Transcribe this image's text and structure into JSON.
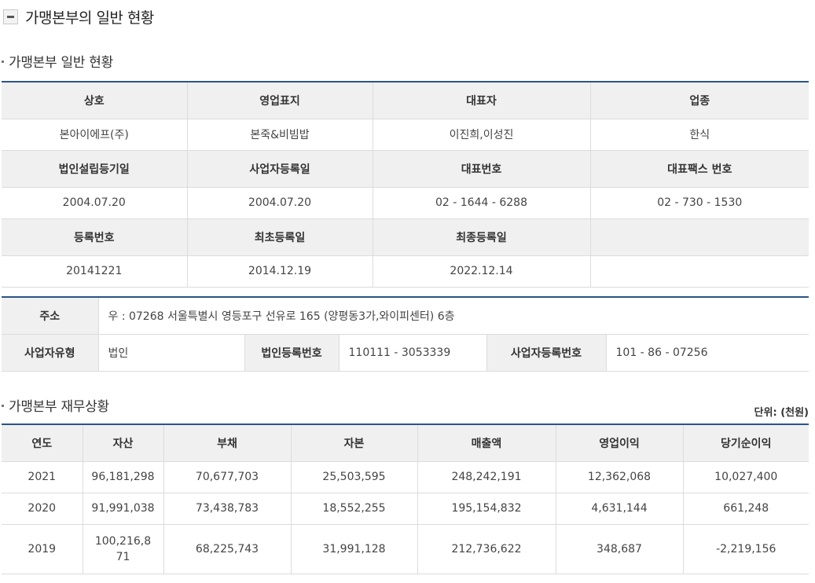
{
  "page_title": "가맹본부의 일반 현황",
  "general_section": {
    "title": "가맹본부 일반 현황",
    "headers1": [
      "상호",
      "영업표지",
      "대표자",
      "업종"
    ],
    "row1": [
      "본아이에프(주)",
      "본죽&비빔밥",
      "이진희,이성진",
      "한식"
    ],
    "headers2": [
      "법인설립등기일",
      "사업자등록일",
      "대표번호",
      "대표팩스 번호"
    ],
    "row2": [
      "2004.07.20",
      "2004.07.20",
      "02 - 1644 - 6288",
      "02 - 730 - 1530"
    ],
    "headers3": [
      "등록번호",
      "최초등록일",
      "최종등록일",
      ""
    ],
    "row3": [
      "20141221",
      "2014.12.19",
      "2022.12.14",
      ""
    ]
  },
  "address_section": {
    "address_label": "주소",
    "address_value": "우 : 07268 서울특별시 영등포구 선유로 165 (양평동3가,와이피센터) 6층",
    "biz_type_label": "사업자유형",
    "biz_type_value": "법인",
    "corp_reg_label": "법인등록번호",
    "corp_reg_value": "110111 - 3053339",
    "biz_reg_label": "사업자등록번호",
    "biz_reg_value": "101 - 86 - 07256"
  },
  "finance_section": {
    "title": "가맹본부 재무상황",
    "unit": "단위: (천원)",
    "headers": [
      "연도",
      "자산",
      "부채",
      "자본",
      "매출액",
      "영업이익",
      "당기순이익"
    ],
    "rows": [
      [
        "2021",
        "96,181,298",
        "70,677,703",
        "25,503,595",
        "248,242,191",
        "12,362,068",
        "10,027,400"
      ],
      [
        "2020",
        "91,991,038",
        "73,438,783",
        "18,552,255",
        "195,154,832",
        "4,631,144",
        "661,248"
      ],
      [
        "2019",
        "100,216,871",
        "68,225,743",
        "31,991,128",
        "212,736,622",
        "348,687",
        "-2,219,156"
      ]
    ]
  }
}
